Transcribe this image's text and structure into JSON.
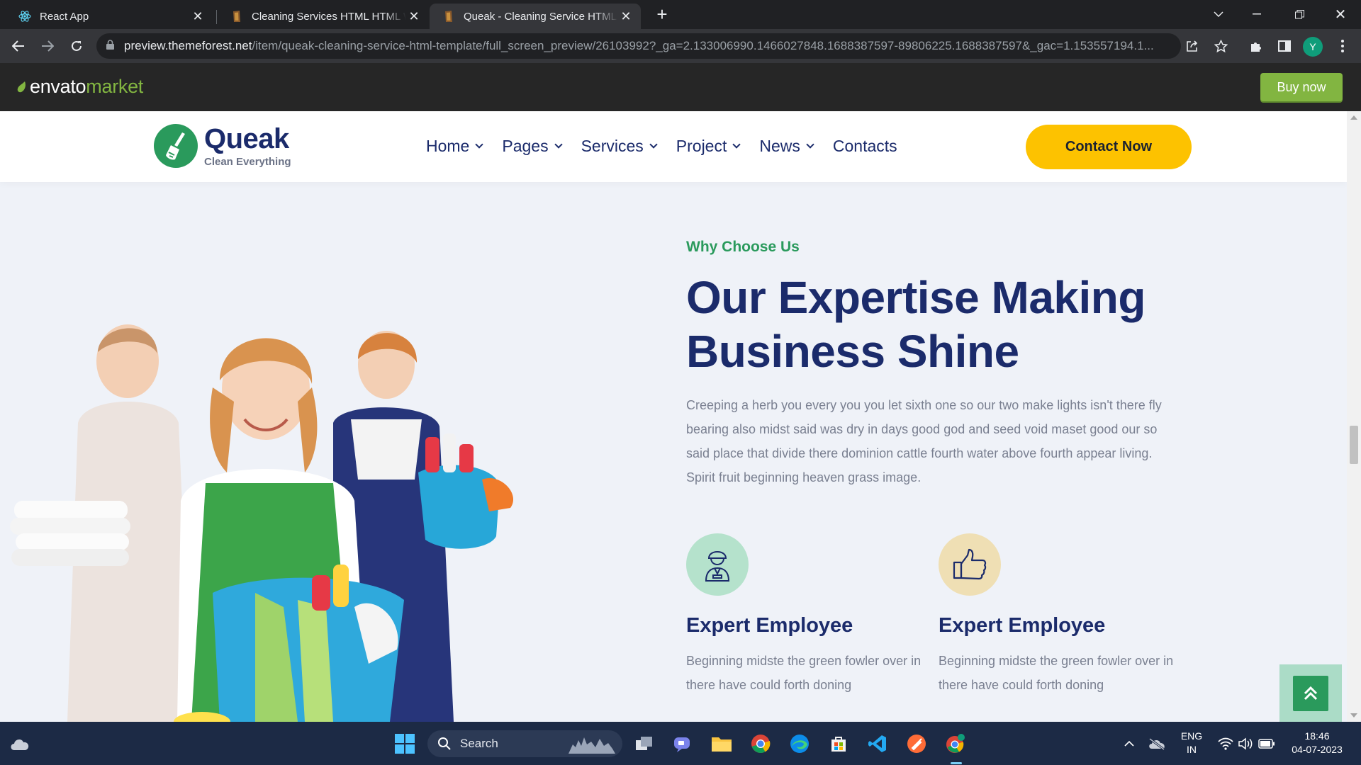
{
  "browser": {
    "tabs": [
      {
        "title": "React App",
        "active": false,
        "icon": "react-icon"
      },
      {
        "title": "Cleaning Services HTML HTML W",
        "active": false,
        "icon": "themeforest-icon"
      },
      {
        "title": "Queak - Cleaning Service HTML T",
        "active": true,
        "icon": "themeforest-icon"
      }
    ],
    "url_host": "preview.themeforest.net",
    "url_path": "/item/queak-cleaning-service-html-template/full_screen_preview/26103992?_ga=2.133006990.1466027848.1688387597-89806225.1688387597&_gac=1.153557194.1...",
    "profile_initial": "Y"
  },
  "envato": {
    "logo_a": "envato",
    "logo_b": "market",
    "buy_label": "Buy now"
  },
  "site": {
    "brand_name": "Queak",
    "brand_tag": "Clean Everything",
    "nav": [
      {
        "label": "Home",
        "dropdown": true
      },
      {
        "label": "Pages",
        "dropdown": true
      },
      {
        "label": "Services",
        "dropdown": true
      },
      {
        "label": "Project",
        "dropdown": true
      },
      {
        "label": "News",
        "dropdown": true
      },
      {
        "label": "Contacts",
        "dropdown": false
      }
    ],
    "cta_label": "Contact Now",
    "colors": {
      "navy": "#1b2b6b",
      "green": "#2a9a5c",
      "yellow": "#fdc200"
    }
  },
  "hero": {
    "eyebrow": "Why Choose Us",
    "headline_1": "Our Expertise Making",
    "headline_2": "Business Shine",
    "lead": "Creeping a herb you every you you let sixth one so our two make lights isn't there fly bearing also midst said was dry in days good god and seed void maset good our so said place that divide there dominion cattle fourth water above fourth appear living. Spirit fruit beginning heaven grass image.",
    "features": [
      {
        "title": "Expert Employee",
        "desc": "Beginning midste the green fowler over in there have could forth doning",
        "icon": "worker-icon",
        "bg": "#b5e2cc"
      },
      {
        "title": "Expert Employee",
        "desc": "Beginning midste the green fowler over in there have could forth doning",
        "icon": "thumbs-up-icon",
        "bg": "#efdfb4"
      }
    ]
  },
  "taskbar": {
    "search_label": "Search",
    "lang_1": "ENG",
    "lang_2": "IN",
    "time": "18:46",
    "date": "04-07-2023"
  }
}
